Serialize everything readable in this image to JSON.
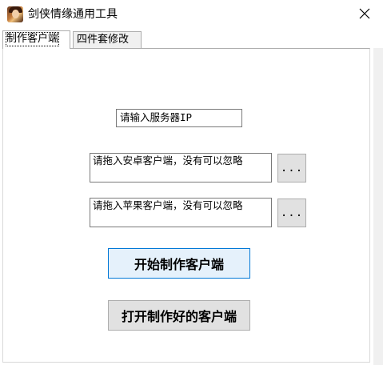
{
  "window": {
    "title": "剑侠情缘通用工具",
    "icon": "game-character-icon",
    "close_icon": "close-icon"
  },
  "tabs": [
    {
      "label": "制作客户端",
      "active": true
    },
    {
      "label": "四件套修改",
      "active": false
    }
  ],
  "form": {
    "server_ip_value": "请输入服务器IP",
    "android_client_value": "请拖入安卓客户端，没有可以忽略",
    "android_browse_label": "...",
    "ios_client_value": "请拖入苹果客户端，没有可以忽略",
    "ios_browse_label": "..."
  },
  "actions": {
    "make_client_label": "开始制作客户端",
    "open_client_label": "打开制作好的客户端"
  },
  "colors": {
    "focus_border": "#0078d7",
    "focus_bg": "#e5f1fb",
    "button_bg": "#e1e1e1"
  }
}
